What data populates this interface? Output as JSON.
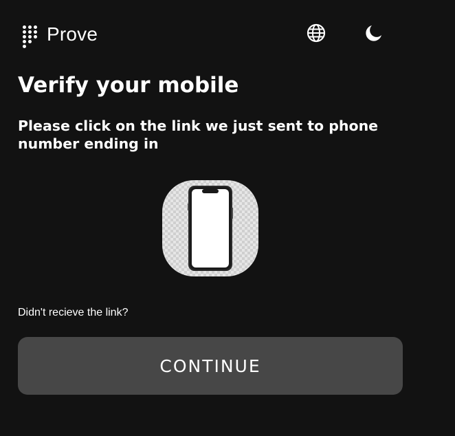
{
  "header": {
    "brand": "Prove",
    "icons": {
      "logo": "prove-dots-logo-icon",
      "language": "globe-icon",
      "theme": "moon-icon"
    }
  },
  "main": {
    "title": "Verify your mobile",
    "subtitle": "Please click on the link we just sent to phone number ending in",
    "illustration": "phone-illustration",
    "resend_text": "Didn't recieve the link?",
    "continue_label": "CONTINUE"
  },
  "colors": {
    "background": "#121212",
    "text": "#ffffff",
    "button": "#474747"
  }
}
